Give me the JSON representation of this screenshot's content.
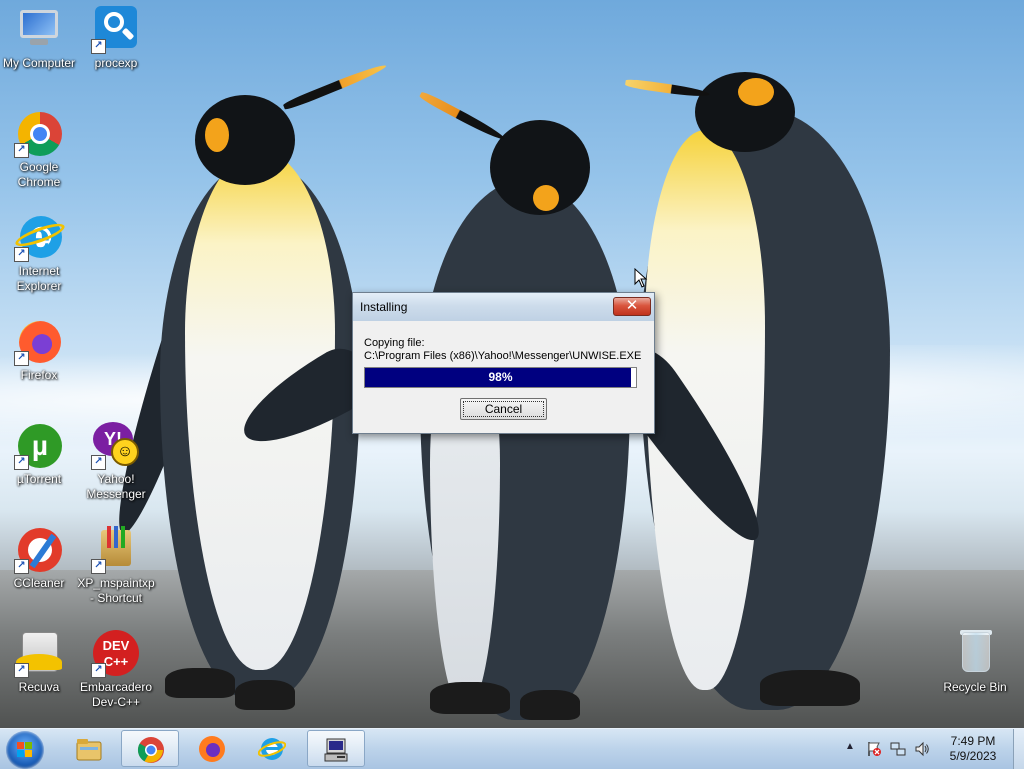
{
  "desktop": {
    "icons": [
      {
        "label": "My Computer",
        "icon": "computer-icon"
      },
      {
        "label": "procexp",
        "icon": "procexp-icon"
      },
      {
        "label": "Google Chrome",
        "icon": "chrome-icon"
      },
      {
        "label": "Internet Explorer",
        "icon": "ie-icon"
      },
      {
        "label": "Firefox",
        "icon": "firefox-icon"
      },
      {
        "label": "µTorrent",
        "icon": "utorrent-icon"
      },
      {
        "label": "Yahoo! Messenger",
        "icon": "yahoo-messenger-icon"
      },
      {
        "label": "CCleaner",
        "icon": "ccleaner-icon"
      },
      {
        "label": "XP_mspaintxp - Shortcut",
        "icon": "paint-icon"
      },
      {
        "label": "Recuva",
        "icon": "recuva-icon"
      },
      {
        "label": "Embarcadero Dev-C++",
        "icon": "devcpp-icon"
      },
      {
        "label": "Recycle Bin",
        "icon": "recycle-bin-icon"
      }
    ]
  },
  "dialog": {
    "title": "Installing",
    "close_glyph": "✕",
    "copy_label": "Copying file:",
    "copy_path": "C:\\Program Files (x86)\\Yahoo!\\Messenger\\UNWISE.EXE",
    "progress_percent": 98,
    "progress_text": "98%",
    "cancel_label": "Cancel"
  },
  "ico_text": {
    "yahoo": "Y!",
    "dev": "DEV\nC++",
    "utorrent": "µ",
    "ie": "e",
    "shortcut_arrow": "↗"
  },
  "taskbar": {
    "pinned": [
      "explorer-icon",
      "chrome-icon",
      "firefox-icon",
      "ie-icon",
      "installer-icon"
    ],
    "active": "installer-icon",
    "tray": {
      "arrow": "▲",
      "time": "7:49 PM",
      "date": "5/9/2023"
    }
  },
  "colors": {
    "progress_fill": "#000080",
    "close_button": "#c0321c",
    "taskbar": "#bcd3ea"
  }
}
